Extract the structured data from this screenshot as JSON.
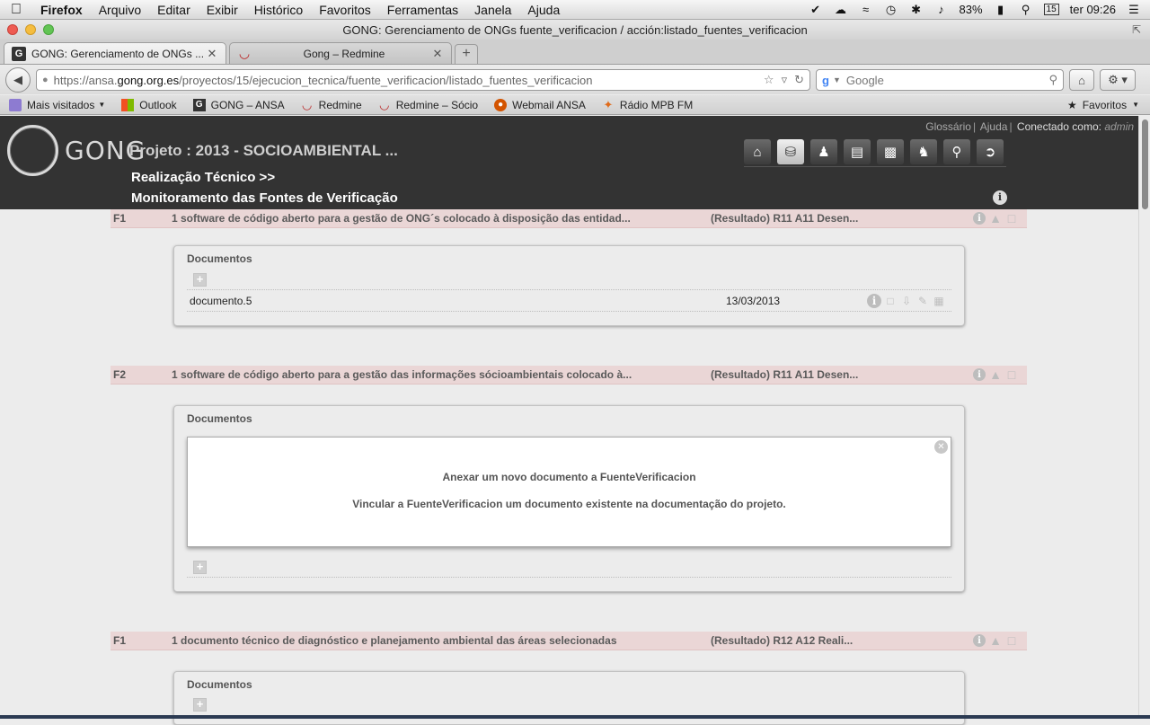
{
  "menubar": {
    "items": [
      "Firefox",
      "Arquivo",
      "Editar",
      "Exibir",
      "Histórico",
      "Favoritos",
      "Ferramentas",
      "Janela",
      "Ajuda"
    ],
    "battery": "83%",
    "date_badge": "15",
    "clock": "ter 09:26"
  },
  "window": {
    "title": "GONG: Gerenciamento de ONGs fuente_verificacion / acción:listado_fuentes_verificacion"
  },
  "tabs": [
    {
      "label": "GONG: Gerenciamento de ONGs ...",
      "favicon": "G",
      "active": true
    },
    {
      "label": "Gong – Redmine",
      "favicon": "redmine-icon",
      "active": false
    }
  ],
  "navbar": {
    "url_prefix": "https://ansa.",
    "url_host": "gong.org.es",
    "url_path": "/proyectos/15/ejecucion_tecnica/fuente_verificacion/listado_fuentes_verificacion",
    "search_placeholder": "Google"
  },
  "bookmarks": [
    {
      "label": "Mais visitados",
      "icon": "folder-icon"
    },
    {
      "label": "Outlook",
      "icon": "outlook-icon"
    },
    {
      "label": "GONG – ANSA",
      "icon": "gong-icon"
    },
    {
      "label": "Redmine",
      "icon": "redmine-icon"
    },
    {
      "label": "Redmine – Sócio",
      "icon": "redmine-icon"
    },
    {
      "label": "Webmail ANSA",
      "icon": "webmail-icon"
    },
    {
      "label": "Rádio MPB FM",
      "icon": "radio-icon"
    }
  ],
  "bookmarks_right": "Favoritos",
  "app": {
    "logo": "GONG",
    "project_title": "Projeto : 2013 - SOCIOAMBIENTAL ...",
    "breadcrumb": "Realização Técnico  >>",
    "page_title": "Monitoramento das Fontes de Verificação",
    "links": {
      "glossary": "Glossário",
      "help": "Ajuda",
      "connected_as": "Conectado como:",
      "user": "admin"
    }
  },
  "sources": [
    {
      "code": "F1",
      "description": "1 software de código aberto para a gestão de ONG´s colocado à disposição das entidad...",
      "result": "(Resultado) R11 A11 Desen...",
      "documents_label": "Documentos",
      "documents": [
        {
          "name": "documento.5",
          "date": "13/03/2013"
        }
      ]
    },
    {
      "code": "F2",
      "description": "1 software de código aberto para a gestão das informações sócioambientais colocado à...",
      "result": "(Resultado) R11 A11 Desen...",
      "documents_label": "Documentos",
      "modal": {
        "line1": "Anexar um novo documento a FuenteVerificacion",
        "line2": "Vincular a FuenteVerificacion um documento existente na documentação do projeto."
      }
    },
    {
      "code": "F1",
      "description": "1 documento técnico de diagnóstico e planejamento ambiental das áreas selecionadas",
      "result": "(Resultado) R12 A12 Reali...",
      "documents_label": "Documentos"
    }
  ],
  "colors": {
    "header_bg": "#333333",
    "row_bg": "#ead6d6",
    "page_bg": "#ececec"
  }
}
